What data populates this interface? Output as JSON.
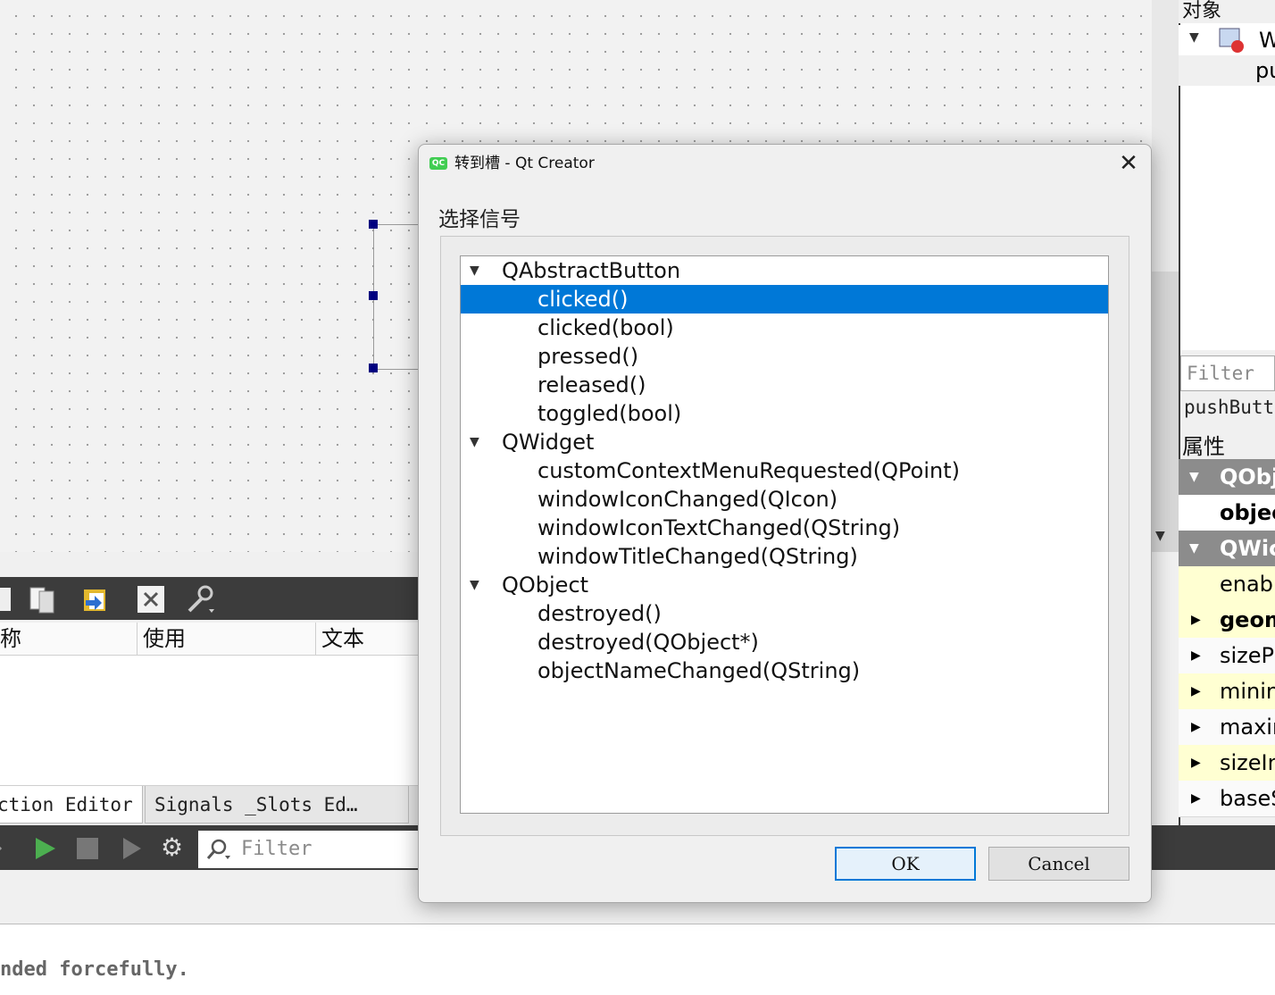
{
  "dialog": {
    "title": "转到槽 - Qt Creator",
    "app_icon": "QC",
    "close_glyph": "✕",
    "signal_label": "选择信号",
    "ok_label": "OK",
    "cancel_label": "Cancel",
    "selection_color": "#0078d7",
    "tree": [
      {
        "group": "QAbstractButton",
        "signals": [
          "clicked()",
          "clicked(bool)",
          "pressed()",
          "released()",
          "toggled(bool)"
        ]
      },
      {
        "group": "QWidget",
        "signals": [
          "customContextMenuRequested(QPoint)",
          "windowIconChanged(QIcon)",
          "windowIconTextChanged(QString)",
          "windowTitleChanged(QString)"
        ]
      },
      {
        "group": "QObject",
        "signals": [
          "destroyed()",
          "destroyed(QObject*)",
          "objectNameChanged(QString)"
        ]
      }
    ],
    "selected_signal": "clicked()"
  },
  "background": {
    "action_table_headers": [
      "称",
      "使用",
      "文本"
    ],
    "editor_tabs": [
      "ction Editor",
      "Signals _Slots Ed…"
    ],
    "filter_placeholder": "Filter",
    "output_text": "nded forcefully.",
    "object_panel_title": "对象",
    "object_root": "W",
    "object_child": "pu",
    "right_filter_placeholder": "Filter",
    "selected_object": "pushButto",
    "property_title": "属性",
    "properties": [
      "QObj",
      "objec",
      "QWic",
      "enabl",
      "geom",
      "sizeP",
      "minin",
      "maxir",
      "sizeIn",
      "baseS"
    ]
  }
}
